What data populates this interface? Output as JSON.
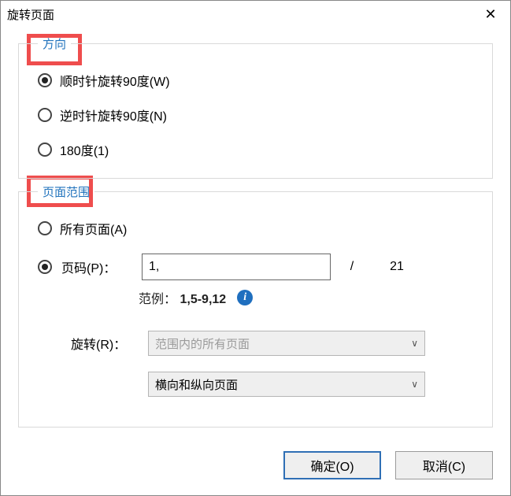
{
  "dialog": {
    "title": "旋转页面",
    "close_glyph": "✕"
  },
  "direction": {
    "legend": "方向",
    "options": {
      "cw90": "顺时针旋转90度(W)",
      "ccw90": "逆时针旋转90度(N)",
      "r180": "180度(1)"
    },
    "selected": "cw90"
  },
  "range": {
    "legend": "页面范围",
    "options": {
      "all": "所有页面(A)",
      "pages": "页码(P)："
    },
    "selected": "pages",
    "page_value": "1,",
    "slash": "/",
    "total": "21",
    "example_label": "范例：",
    "example_value": "1,5-9,12",
    "info_glyph": "i",
    "rotate_label": "旋转(R)：",
    "rotate_select": "范围内的所有页面",
    "orientation_select": "横向和纵向页面",
    "arrow_glyph": "∨"
  },
  "buttons": {
    "ok": "确定(O)",
    "cancel": "取消(C)"
  }
}
